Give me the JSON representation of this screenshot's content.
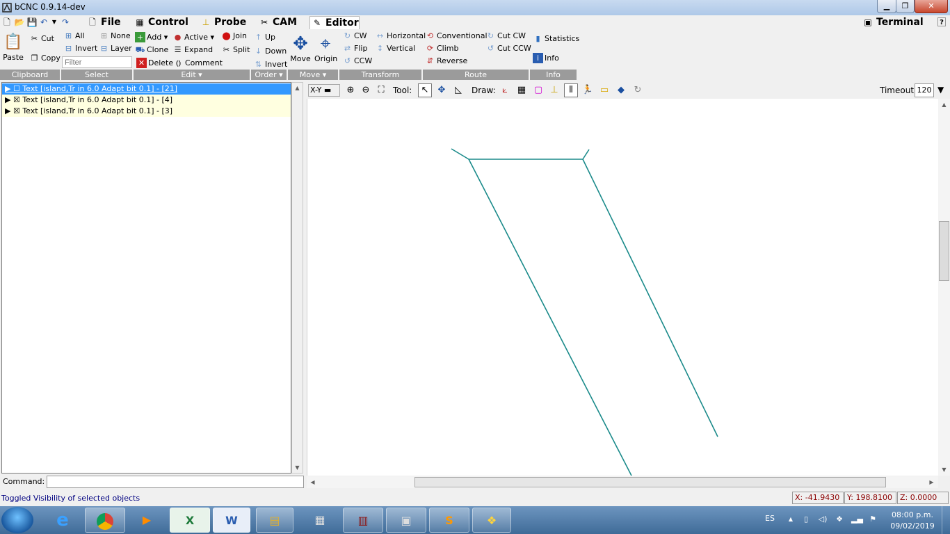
{
  "window": {
    "title": "bCNC 0.9.14-dev",
    "minimize_label": "▁",
    "maximize_label": "❐",
    "close_label": "✕"
  },
  "menu": {
    "tabs": [
      {
        "label": "File",
        "icon": "file-icon"
      },
      {
        "label": "Control",
        "icon": "control-icon"
      },
      {
        "label": "Probe",
        "icon": "probe-icon"
      },
      {
        "label": "CAM",
        "icon": "cam-icon"
      },
      {
        "label": "Editor",
        "icon": "editor-icon",
        "active": true
      }
    ],
    "terminal_label": "Terminal"
  },
  "ribbon": {
    "clipboard": {
      "label": "Clipboard",
      "paste": "Paste",
      "cut": "Cut",
      "copy": "Copy"
    },
    "select": {
      "label": "Select",
      "all": "All",
      "none": "None",
      "invert": "Invert",
      "layer": "Layer",
      "filter_placeholder": "Filter"
    },
    "edit": {
      "label": "Edit",
      "add": "Add",
      "active": "Active",
      "join": "Join",
      "clone": "Clone",
      "expand": "Expand",
      "split": "Split",
      "delete": "Delete",
      "comment": "Comment"
    },
    "order": {
      "label": "Order",
      "up": "Up",
      "down": "Down",
      "invert": "Invert"
    },
    "move": {
      "label": "Move",
      "move": "Move",
      "origin": "Origin"
    },
    "transform": {
      "label": "Transform",
      "cw": "CW",
      "horizontal": "Horizontal",
      "flip": "Flip",
      "vertical": "Vertical",
      "ccw": "CCW"
    },
    "route": {
      "label": "Route",
      "conventional": "Conventional",
      "cut_cw": "Cut CW",
      "climb": "Climb",
      "cut_ccw": "Cut CCW",
      "reverse": "Reverse"
    },
    "info": {
      "label": "Info",
      "statistics": "Statistics",
      "info": "Info"
    }
  },
  "tree": {
    "items": [
      {
        "text": "▶ ☐ Text [island,Tr in 6.0 Adapt bit 0.1] - [21]",
        "selected": true
      },
      {
        "text": "▶ ☒ Text [island,Tr in 6.0 Adapt bit 0.1] - [4]",
        "selected": false
      },
      {
        "text": "▶ ☒ Text [island,Tr in 6.0 Adapt bit 0.1] - [3]",
        "selected": false
      }
    ]
  },
  "canvas_toolbar": {
    "view": "X-Y",
    "tool_label": "Tool:",
    "draw_label": "Draw:",
    "timeout_label": "Timeout:",
    "timeout_value": "120"
  },
  "command": {
    "label": "Command:",
    "value": ""
  },
  "status": {
    "message": "Toggled Visibility of selected objects",
    "x": "X: -41.9430",
    "y": "Y: 198.8100",
    "z": "Z: 0.0000"
  },
  "taskbar": {
    "lang": "ES",
    "time": "08:00 p.m.",
    "date": "09/02/2019"
  },
  "colors": {
    "path": "#1a8a8a",
    "selection": "#3399ff",
    "tree_alt": "#ffffe0"
  }
}
